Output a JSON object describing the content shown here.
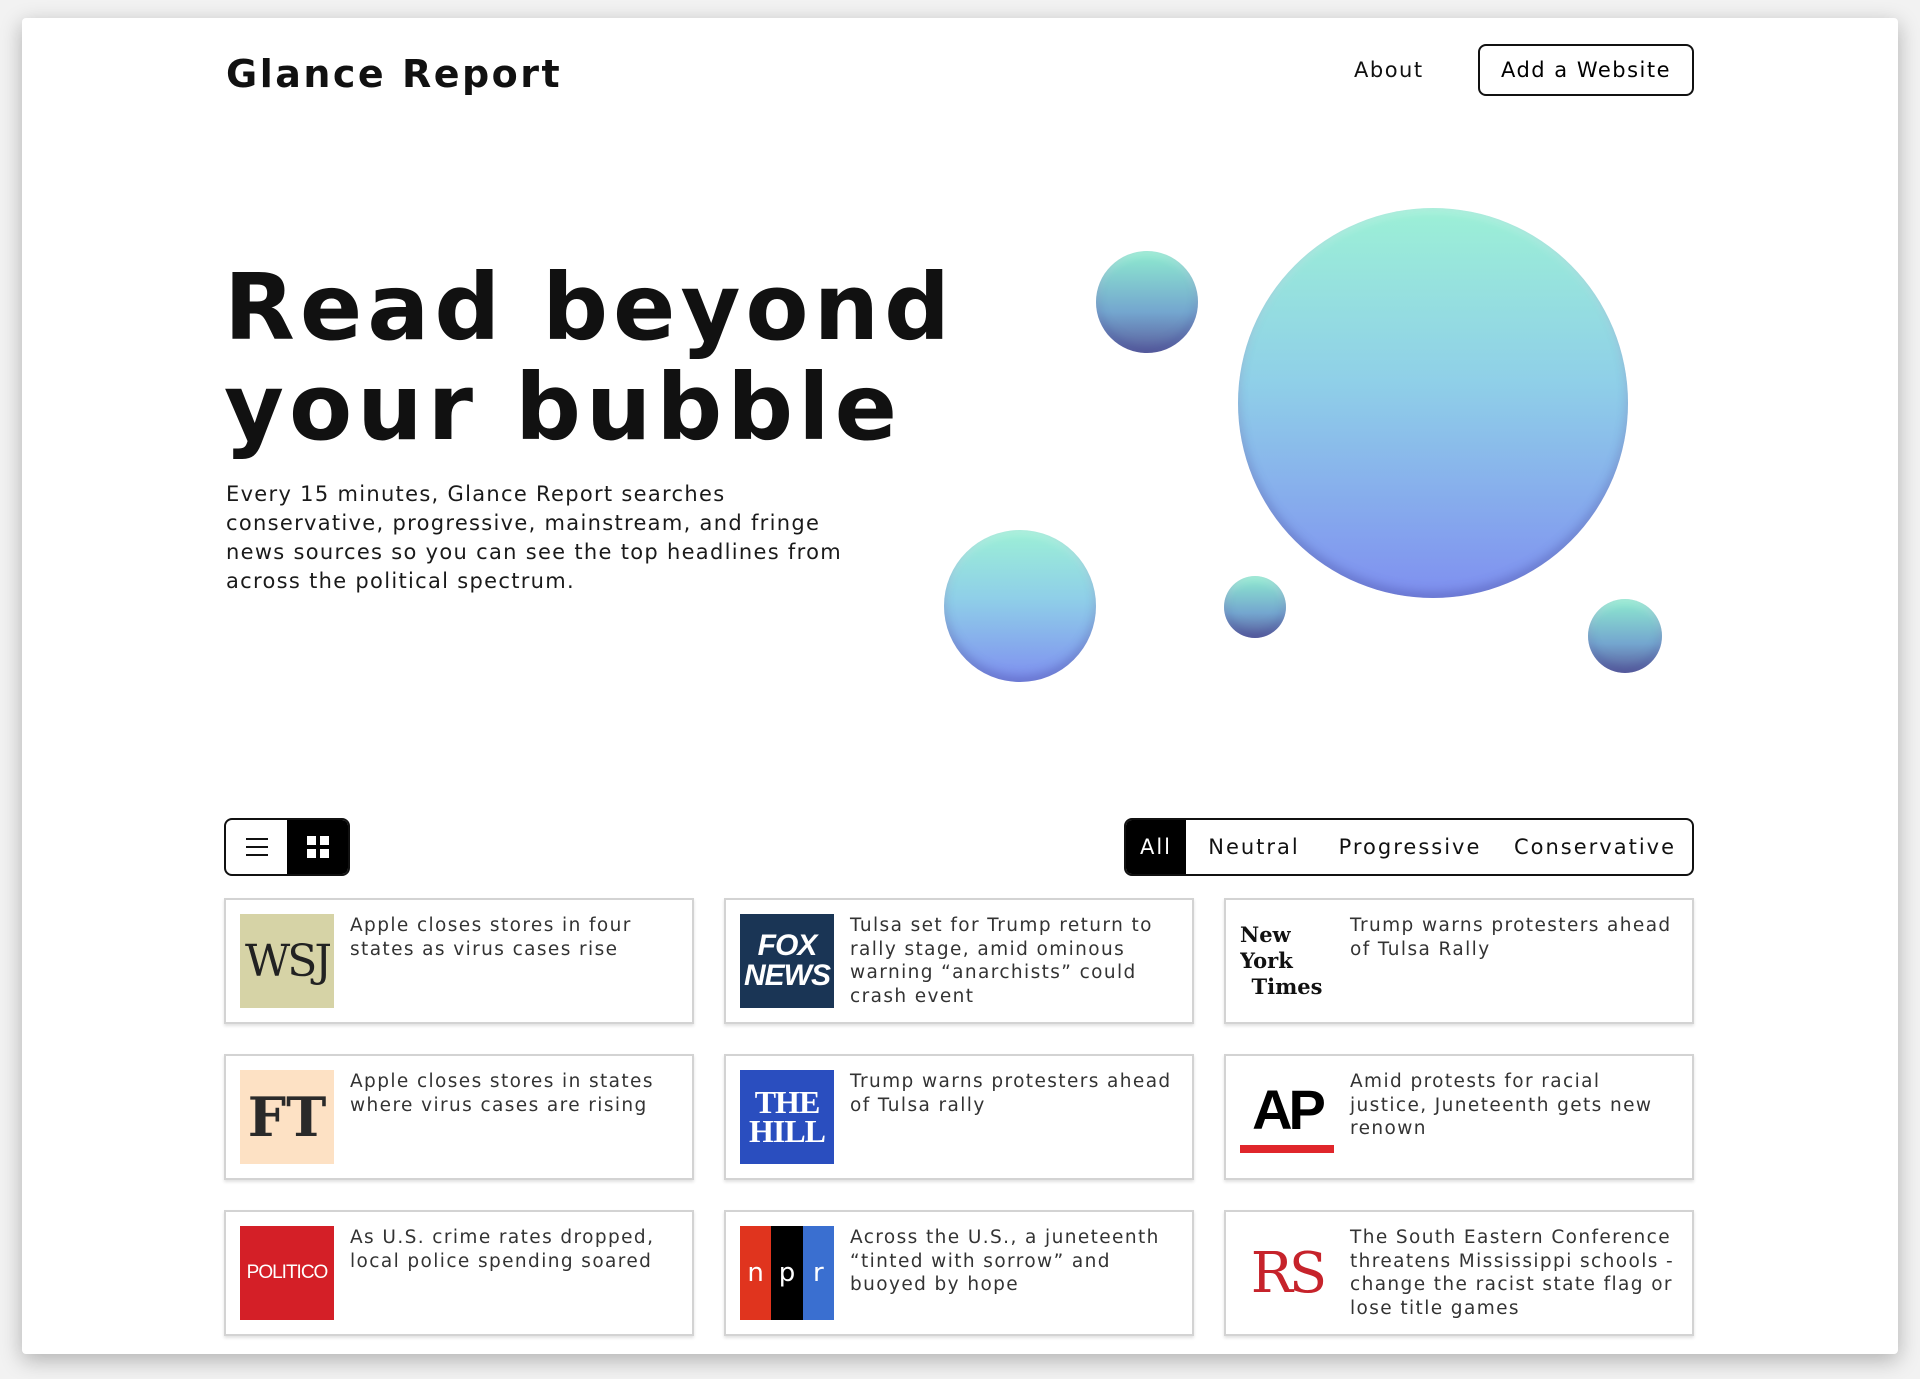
{
  "header": {
    "logo": "Glance Report",
    "about": "About",
    "add_website": "Add a Website"
  },
  "hero": {
    "title_line1": "Read beyond",
    "title_line2": "your bubble",
    "description": "Every 15 minutes, Glance Report searches conservative, progressive, mainstream, and fringe news sources so you can see the top headlines from across the political spectrum."
  },
  "view_toggle": {
    "list_icon": "list-icon",
    "grid_icon": "grid-icon",
    "active": "grid"
  },
  "filters": [
    {
      "label": "All",
      "active": true
    },
    {
      "label": "Neutral",
      "active": false
    },
    {
      "label": "Progressive",
      "active": false
    },
    {
      "label": "Conservative",
      "active": false
    }
  ],
  "colors": {
    "accent": "#000000",
    "bubble_top": "#9cf0d6",
    "bubble_bottom": "#7f8ff0"
  },
  "cards": [
    {
      "source_logo": "WSJ",
      "headline": "Apple closes stores in four states as virus cases rise"
    },
    {
      "source_logo_line1": "FOX",
      "source_logo_line2": "NEWS",
      "headline": "Tulsa set for Trump return to rally stage, amid ominous warning “anarchists” could crash event"
    },
    {
      "source_logo_line1": "New York",
      "source_logo_line2": "Times",
      "headline": "Trump warns protesters ahead of Tulsa Rally"
    },
    {
      "source_logo": "FT",
      "headline": "Apple closes stores in states where virus cases are rising"
    },
    {
      "source_logo_line1": "THE",
      "source_logo_line2": "HILL",
      "headline": "Trump warns protesters ahead of Tulsa rally"
    },
    {
      "source_logo": "AP",
      "headline": "Amid protests for racial justice, Juneteenth gets new renown"
    },
    {
      "source_logo": "POLITICO",
      "headline": "As U.S. crime rates dropped, local police spending soared"
    },
    {
      "source_logo_n": "n",
      "source_logo_p": "p",
      "source_logo_r": "r",
      "headline": "Across the U.S., a juneteenth “tinted with sorrow” and buoyed by hope"
    },
    {
      "source_logo": "RS",
      "headline": "The South Eastern Conference threatens Mississippi schools - change the racist state flag or lose title games"
    }
  ]
}
